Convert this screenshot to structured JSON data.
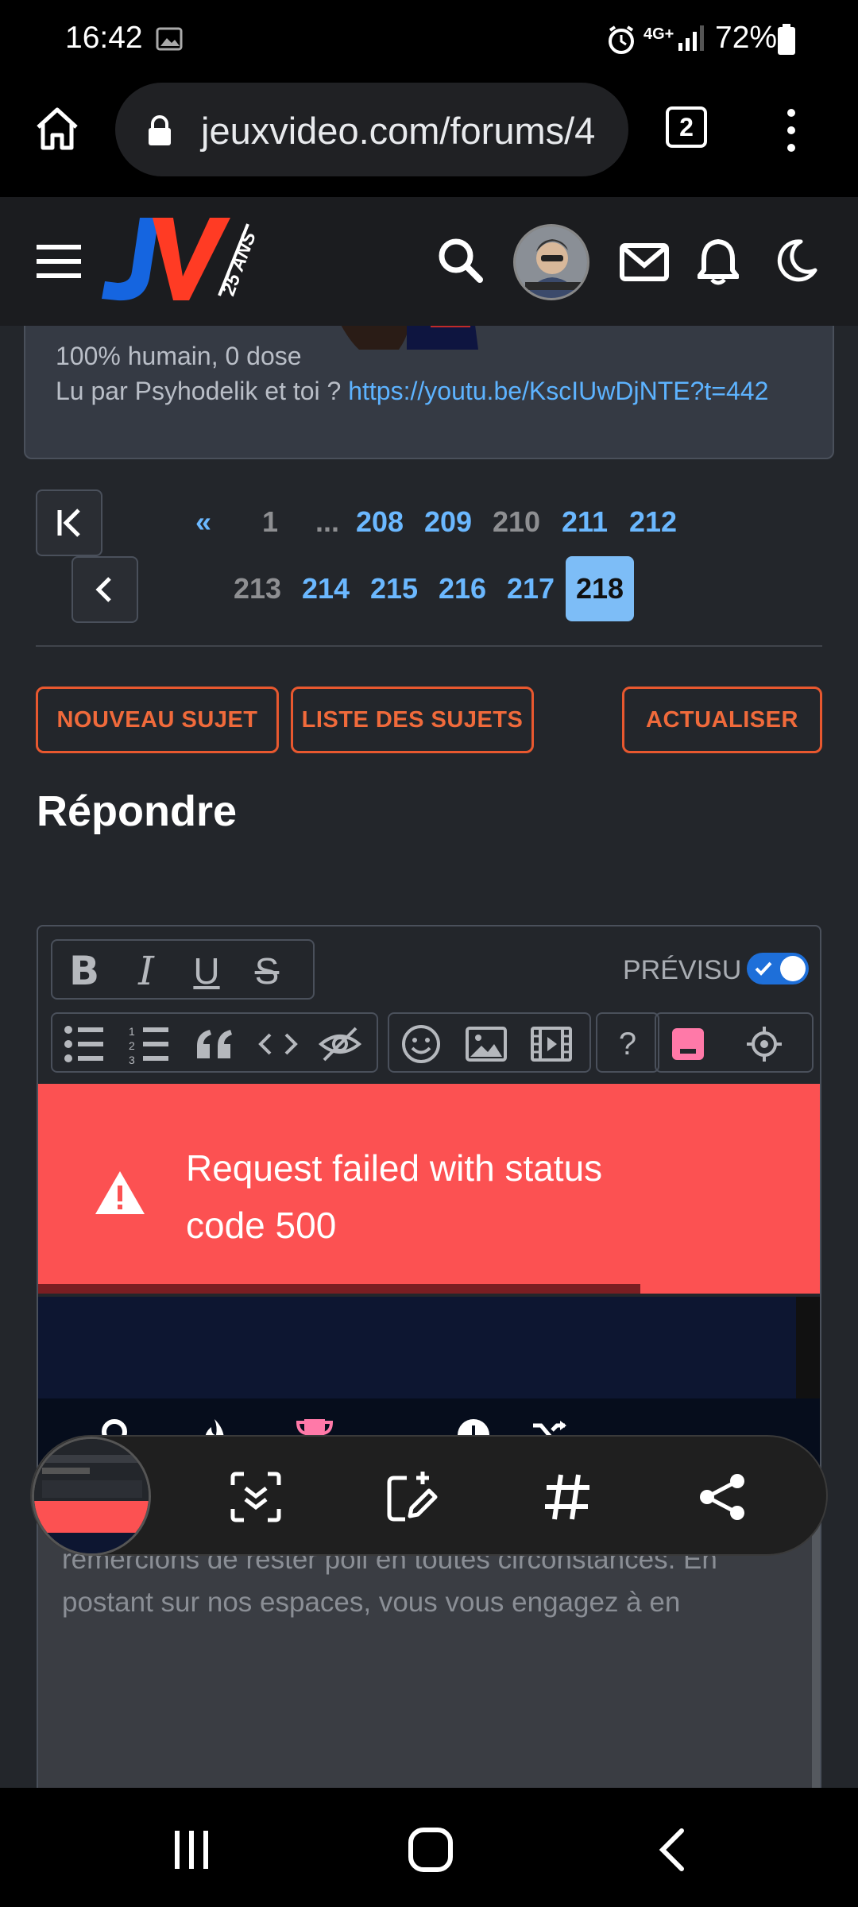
{
  "status_bar": {
    "time": "16:42",
    "network": "4G+",
    "battery": "72%"
  },
  "browser": {
    "url": "jeuxvideo.com/forums/4",
    "tab_count": "2"
  },
  "header": {
    "logo_text": "JV",
    "logo_badge": "25 ANS"
  },
  "signature": {
    "line1": "100% humain, 0 dose",
    "line2_prefix": "Lu par Psyhodelik et toi ? ",
    "line2_link": "https://youtu.be/KscIUwDjNTE?t=442"
  },
  "pagination": {
    "prev_label": "«",
    "row1": [
      "1",
      "...",
      "208",
      "209",
      "210",
      "211",
      "212"
    ],
    "row2": [
      "213",
      "214",
      "215",
      "216",
      "217",
      "218"
    ],
    "current": "218"
  },
  "actions": {
    "new_topic": "NOUVEAU SUJET",
    "topic_list": "LISTE DES SUJETS",
    "refresh": "ACTUALISER"
  },
  "reply": {
    "heading": "Répondre",
    "preview_label": "PRÉVISU",
    "preview_enabled": true,
    "help_label": "?",
    "error_message": "Request failed with status code 500",
    "placeholder": "Pour que les discussions restent agréables, nous vous remercions de rester poli en toutes circonstances. En postant sur nos espaces, vous vous engagez à en"
  },
  "colors": {
    "accent_orange": "#e8582f",
    "link_blue": "#6bb8ff",
    "error_red": "#fc5152",
    "active_page": "#7dbdf7",
    "trophy_pink": "#ff79a8"
  }
}
